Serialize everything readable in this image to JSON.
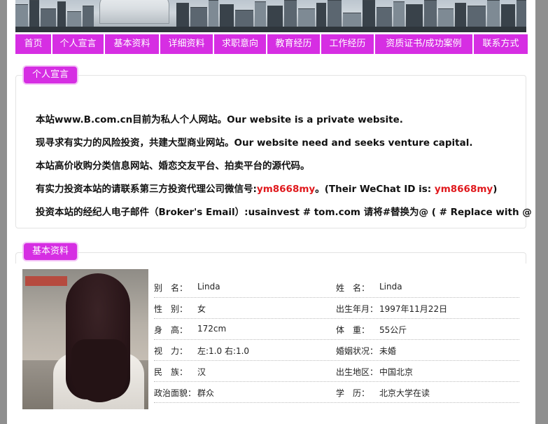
{
  "nav": {
    "items": [
      "首页",
      "个人宣言",
      "基本资料",
      "详细资料",
      "求职意向",
      "教育经历",
      "工作经历",
      "资质证书/成功案例",
      "联系方式"
    ]
  },
  "declaration": {
    "tag": "个人宣言",
    "line1": "本站www.B.com.cn目前为私人个人网站。Our website is a private website.",
    "line2": "现寻求有实力的风险投资，共建大型商业网站。Our website need and seeks venture capital.",
    "line3": "本站高价收购分类信息网站、婚恋交友平台、拍卖平台的源代码。",
    "line4_prefix": "有实力投资本站的请联系第三方投资代理公司微信号:",
    "line4_wechat": "ym8668my",
    "line4_middle": "。(Their WeChat ID is: ",
    "line4_wechat2": "ym8668my",
    "line4_suffix": ")",
    "line5": "投资本站的经纪人电子邮件（Broker's Email）:usainvest # tom.com 请将#替换为@ ( # Replace with @ )。"
  },
  "basic": {
    "tag": "基本资料",
    "rows": [
      {
        "l1": "别　名：",
        "v1": "Linda",
        "l2": "姓　名：",
        "v2": "Linda"
      },
      {
        "l1": "性　别：",
        "v1": "女",
        "l2": "出生年月：",
        "v2": "1997年11月22日"
      },
      {
        "l1": "身　高：",
        "v1": "172cm",
        "l2": "体　重：",
        "v2": "55公斤"
      },
      {
        "l1": "视　力：",
        "v1": "左:1.0 右:1.0",
        "l2": "婚姻状况：",
        "v2": "未婚"
      },
      {
        "l1": "民　族：",
        "v1": "汉",
        "l2": "出生地区：",
        "v2": "中国北京"
      },
      {
        "l1": "政治面貌：",
        "v1": "群众",
        "l2": "学　历：",
        "v2": "北京大学在读"
      }
    ]
  },
  "colors": {
    "accent": "#d62ee3",
    "highlight": "#e0191d",
    "background": "#8f8f8f"
  }
}
